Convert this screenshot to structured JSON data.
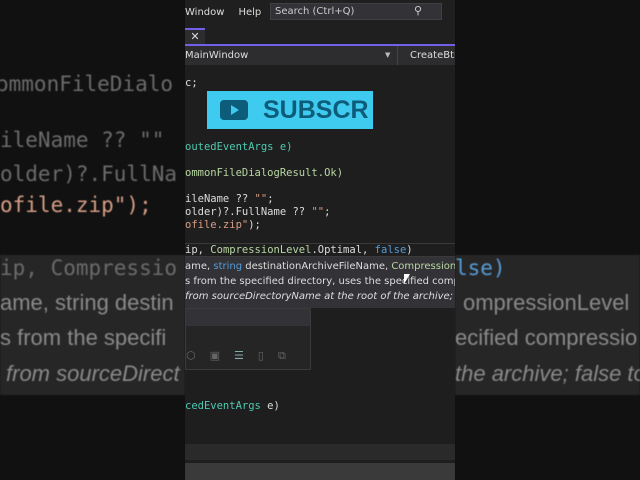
{
  "menu": {
    "window": "Window",
    "help": "Help",
    "search_placeholder": "Search (Ctrl+Q)"
  },
  "tab": {
    "close": "✕"
  },
  "nav": {
    "class_dropdown": "MainWindow",
    "member_dropdown": "CreateBtn_"
  },
  "code": {
    "l1": "c;",
    "l2": "outedEventArgs e)",
    "l3": "ommonFileDialogResult.Ok)",
    "l4a": "ileName ?? ",
    "l4b": "\"\"",
    "l4c": ";",
    "l5a": "older)?.FullName ?? ",
    "l5b": "\"\"",
    "l5c": ";",
    "l6a": "ofile.zip\"",
    "l6b": ");",
    "l7a": "ip, ",
    "l7b": "CompressionLevel",
    "l7c": ".Optimal, ",
    "l7d": "false",
    "l7e": ")",
    "l8a": "cedEventArgs",
    "l8b": " e)"
  },
  "banner": {
    "text": "SUBSCR"
  },
  "tooltip": {
    "sig_a": "ame, ",
    "sig_b": "string",
    " sig_c": "",
    "sig_d": " destinationArchiveFileName, ",
    "sig_e": "CompressionLevel",
    "desc": "s from the specified directory, uses the specified compression",
    "param": "from sourceDirectoryName at the root of the archive; false to"
  },
  "bg_left": [
    "ommonFileDialo",
    "ileName ?? \"\"",
    "older)?.FullNa",
    "ofile.zip\");",
    "ip, Compressio",
    "ame, string destin",
    "s from the specifi",
    "from sourceDirect"
  ],
  "bg_right": [
    "lse)",
    "ompressionLevel",
    "ecified compressio",
    "the archive; false to"
  ]
}
